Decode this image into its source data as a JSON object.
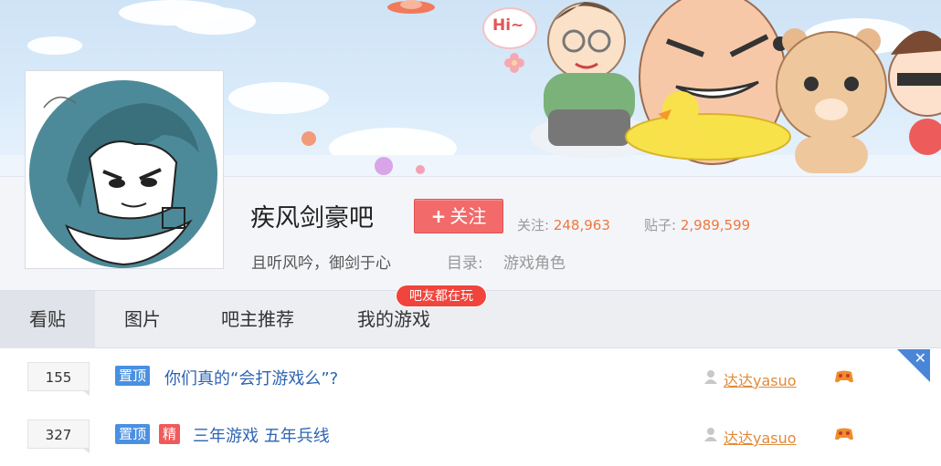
{
  "banner": {
    "greeting": "Hi~"
  },
  "forum": {
    "name": "疾风剑豪吧",
    "follow_label": "关注",
    "follow_plus": "+",
    "followers_label": "关注:",
    "followers_value": "248,963",
    "posts_label": "贴子:",
    "posts_value": "2,989,599",
    "slogan": "且听风吟，御剑于心",
    "directory_label": "目录:",
    "directory_value": "游戏角色"
  },
  "tabs": [
    {
      "label": "看贴",
      "active": true
    },
    {
      "label": "图片"
    },
    {
      "label": "吧主推荐"
    },
    {
      "label": "我的游戏"
    }
  ],
  "game_badge": "吧友都在玩",
  "threads": [
    {
      "replies": "155",
      "tags": [
        "置顶"
      ],
      "title": "你们真的“会打游戏么”?",
      "author": "达达yasuo"
    },
    {
      "replies": "327",
      "tags": [
        "置顶",
        "精"
      ],
      "title": "三年游戏 五年兵线",
      "author": "达达yasuo"
    }
  ],
  "colors": {
    "accent_red": "#f26a6a",
    "link_blue": "#2d64b3",
    "number_orange": "#f0783c",
    "author_orange": "#e08a3a",
    "tag_blue": "#4a90e2"
  },
  "icons": [
    "user-icon",
    "game-controller-icon",
    "close-icon",
    "plus-icon"
  ]
}
